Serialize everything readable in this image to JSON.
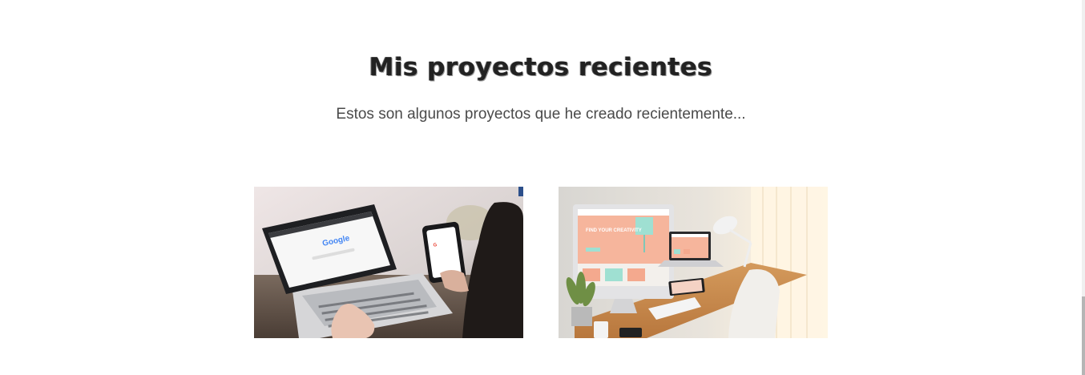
{
  "section": {
    "title": "Mis proyectos recientes",
    "subtitle": "Estos son algunos proyectos que he creado recientemente..."
  },
  "projects": [
    {
      "image": "laptop-and-phone-google-search-photo",
      "screen_text": "Google"
    },
    {
      "image": "desktop-responsive-devices-workspace-photo",
      "screen_text": "FIND YOUR CREATIVITY"
    }
  ],
  "colors": {
    "background": "#ffffff",
    "title": "#222222",
    "subtitle": "#4a4a4a",
    "accent_salmon": "#f4a98e",
    "accent_mint": "#9fe0d2"
  }
}
